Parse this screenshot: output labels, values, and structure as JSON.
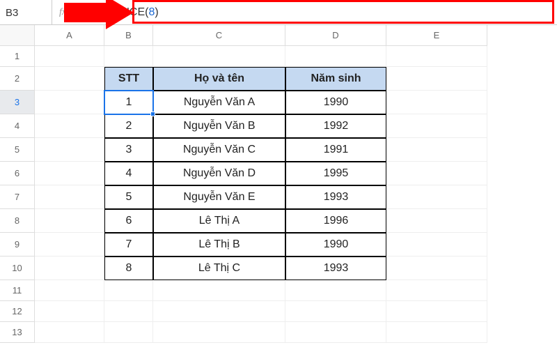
{
  "cellRef": "B3",
  "formula": {
    "prefix": "=SEQUENCE(",
    "arg": "8",
    "suffix": ")"
  },
  "fxLabel": "fx",
  "columns": [
    "A",
    "B",
    "C",
    "D",
    "E"
  ],
  "rowNumbers": [
    "1",
    "2",
    "3",
    "4",
    "5",
    "6",
    "7",
    "8",
    "9",
    "10",
    "11",
    "12",
    "13"
  ],
  "selectedRow": "3",
  "table": {
    "headers": {
      "stt": "STT",
      "name": "Họ và tên",
      "year": "Năm sinh"
    },
    "rows": [
      {
        "stt": "1",
        "name": "Nguyễn Văn A",
        "year": "1990"
      },
      {
        "stt": "2",
        "name": "Nguyễn Văn B",
        "year": "1992"
      },
      {
        "stt": "3",
        "name": "Nguyễn Văn C",
        "year": "1991"
      },
      {
        "stt": "4",
        "name": "Nguyễn Văn D",
        "year": "1995"
      },
      {
        "stt": "5",
        "name": "Nguyễn Văn E",
        "year": "1993"
      },
      {
        "stt": "6",
        "name": "Lê Thị A",
        "year": "1996"
      },
      {
        "stt": "7",
        "name": "Lê Thị B",
        "year": "1990"
      },
      {
        "stt": "8",
        "name": "Lê Thị C",
        "year": "1993"
      }
    ]
  }
}
